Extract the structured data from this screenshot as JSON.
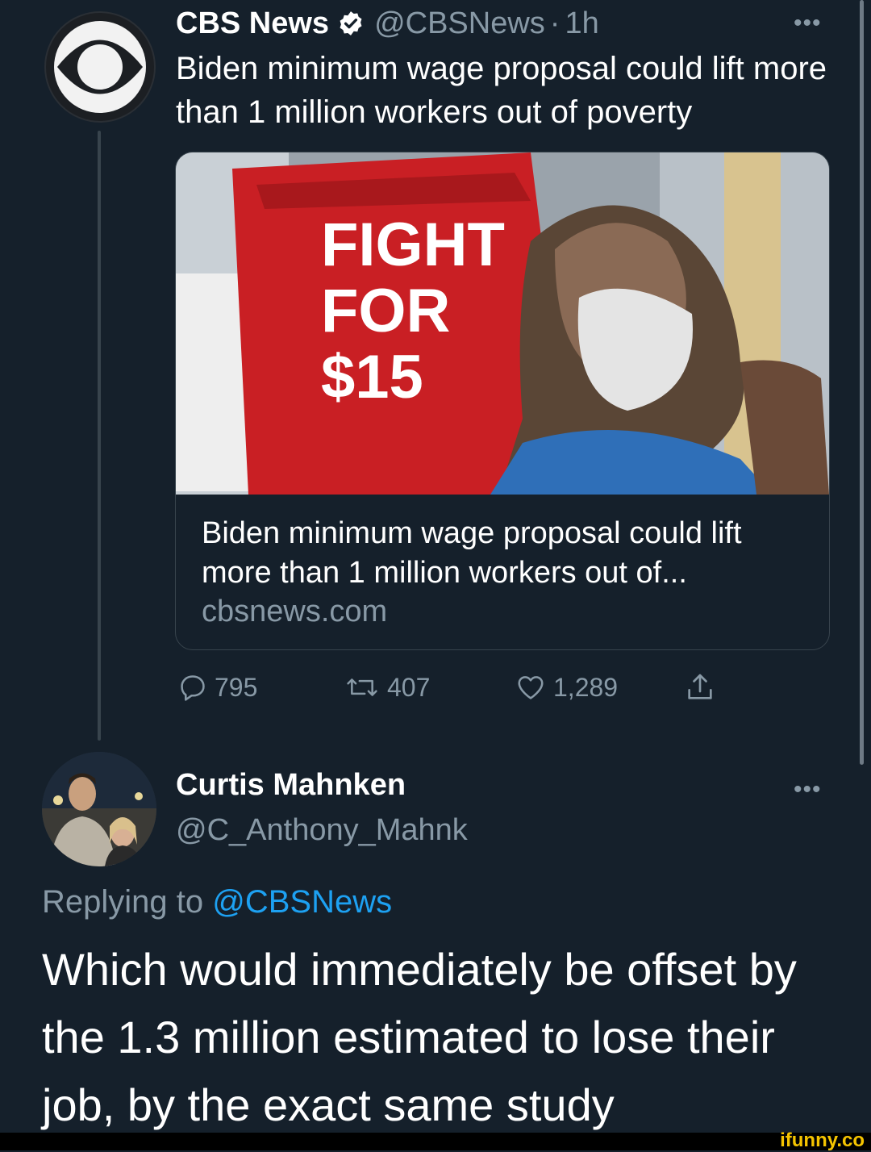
{
  "parent_tweet": {
    "author_name": "CBS News",
    "handle": "@CBSNews",
    "separator": "·",
    "time": "1h",
    "text": "Biden minimum wage proposal could lift more than 1 million workers out of poverty",
    "card": {
      "title": "Biden minimum wage proposal could lift more than 1 million workers out of...",
      "domain": "cbsnews.com",
      "image_sign_text": "FIGHT FOR $15"
    },
    "actions": {
      "replies": "795",
      "retweets": "407",
      "likes": "1,289"
    }
  },
  "reply_tweet": {
    "author_name": "Curtis Mahnken",
    "handle": "@C_Anthony_Mahnk",
    "replying_prefix": "Replying to",
    "replying_to": "@CBSNews",
    "text": "Which would immediately be offset by the 1.3 million estimated to lose their job, by the exact same study"
  },
  "more_label": "•••",
  "watermark": "ifunny.co",
  "colors": {
    "background": "#15202b",
    "secondary_text": "#8899a6",
    "link": "#1da1f2",
    "border": "#38444d"
  }
}
